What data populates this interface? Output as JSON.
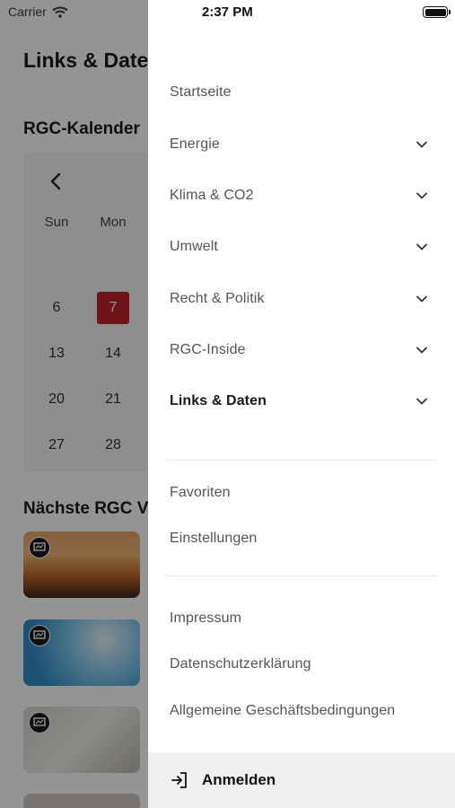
{
  "status_bar": {
    "carrier": "Carrier",
    "time": "2:37 PM"
  },
  "background": {
    "page_title": "Links & Daten",
    "calendar_section": "RGC-Kalender",
    "calendar": {
      "weekdays": [
        "Sun",
        "Mon"
      ],
      "rows": [
        [
          "6",
          "7"
        ],
        [
          "13",
          "14"
        ],
        [
          "20",
          "21"
        ],
        [
          "27",
          "28"
        ]
      ],
      "today": "7"
    },
    "next_section": "Nächste RGC V"
  },
  "drawer": {
    "menu_items": [
      {
        "label": "Startseite",
        "has_chevron": false,
        "active": false
      },
      {
        "label": "Energie",
        "has_chevron": true,
        "active": false
      },
      {
        "label": "Klima & CO2",
        "has_chevron": true,
        "active": false
      },
      {
        "label": "Umwelt",
        "has_chevron": true,
        "active": false
      },
      {
        "label": "Recht & Politik",
        "has_chevron": true,
        "active": false
      },
      {
        "label": "RGC-Inside",
        "has_chevron": true,
        "active": false
      },
      {
        "label": "Links & Daten",
        "has_chevron": true,
        "active": true
      }
    ],
    "secondary_items": [
      {
        "label": "Favoriten"
      },
      {
        "label": "Einstellungen"
      }
    ],
    "legal_items": [
      {
        "label": "Impressum"
      },
      {
        "label": "Datenschutzerklärung"
      },
      {
        "label": "Allgemeine Geschäftsbedingungen"
      }
    ],
    "login": {
      "label": "Anmelden",
      "icon": "login-icon"
    }
  },
  "colors": {
    "accent": "#c0232c",
    "overlay": "rgba(0,0,0,0.42)",
    "drawer_bg": "#ffffff",
    "login_bg": "#efefef"
  }
}
